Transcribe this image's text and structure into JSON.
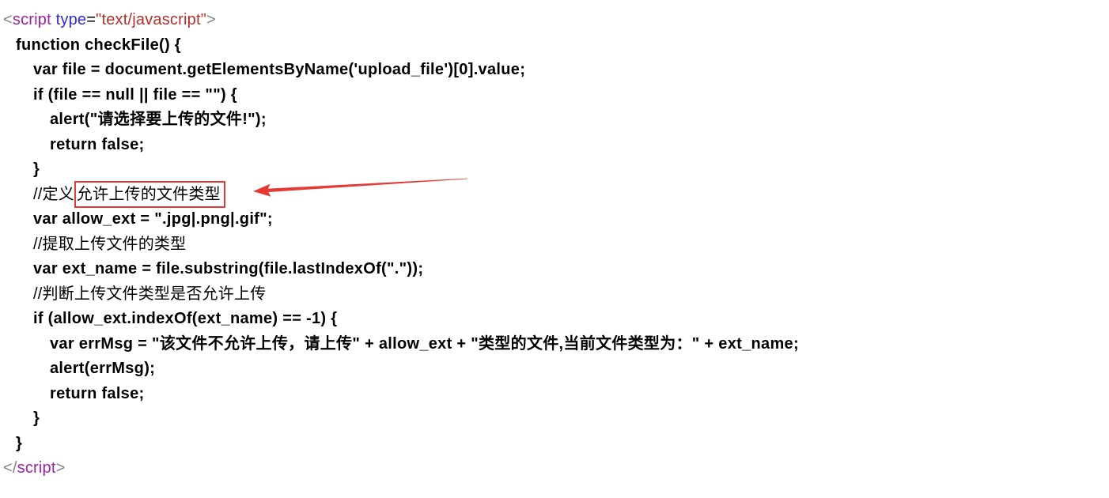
{
  "colors": {
    "text": "#000000",
    "background": "#ffffff",
    "tag_bracket": "#808080",
    "tag_name": "#a020a0",
    "attr_name": "#2b2bd8",
    "attr_value": "#b4302a",
    "annotation": "#e53935"
  },
  "code": {
    "open_tag": {
      "bracket_open": "<",
      "tag_name": "script",
      "attr_name": "type",
      "equals": "=",
      "attr_value": "\"text/javascript\"",
      "bracket_close": ">"
    },
    "lines": [
      {
        "text": "function checkFile() {"
      },
      {
        "text": "var file = document.getElementsByName('upload_file')[0].value;"
      },
      {
        "text": "if (file == null || file == \"\") {"
      },
      {
        "text": "alert(\"请选择要上传的文件!\");"
      },
      {
        "text": "return false;"
      },
      {
        "text": "}"
      },
      {
        "text": "//定义",
        "highlight": "允许上传的文件类型"
      },
      {
        "text": "var allow_ext = \".jpg|.png|.gif\";"
      },
      {
        "text": "//提取上传文件的类型"
      },
      {
        "text": "var ext_name = file.substring(file.lastIndexOf(\".\"));"
      },
      {
        "text": "//判断上传文件类型是否允许上传"
      },
      {
        "text": "if (allow_ext.indexOf(ext_name) == -1) {"
      },
      {
        "text": "var errMsg = \"该文件不允许上传，请上传\" + allow_ext + \"类型的文件,当前文件类型为：\" + ext_name;"
      },
      {
        "text": "alert(errMsg);"
      },
      {
        "text": "return false;"
      },
      {
        "text": "}"
      },
      {
        "text": "}"
      }
    ],
    "close_tag": {
      "bracket_open": "</",
      "tag_name": "script",
      "bracket_close": ">"
    }
  }
}
